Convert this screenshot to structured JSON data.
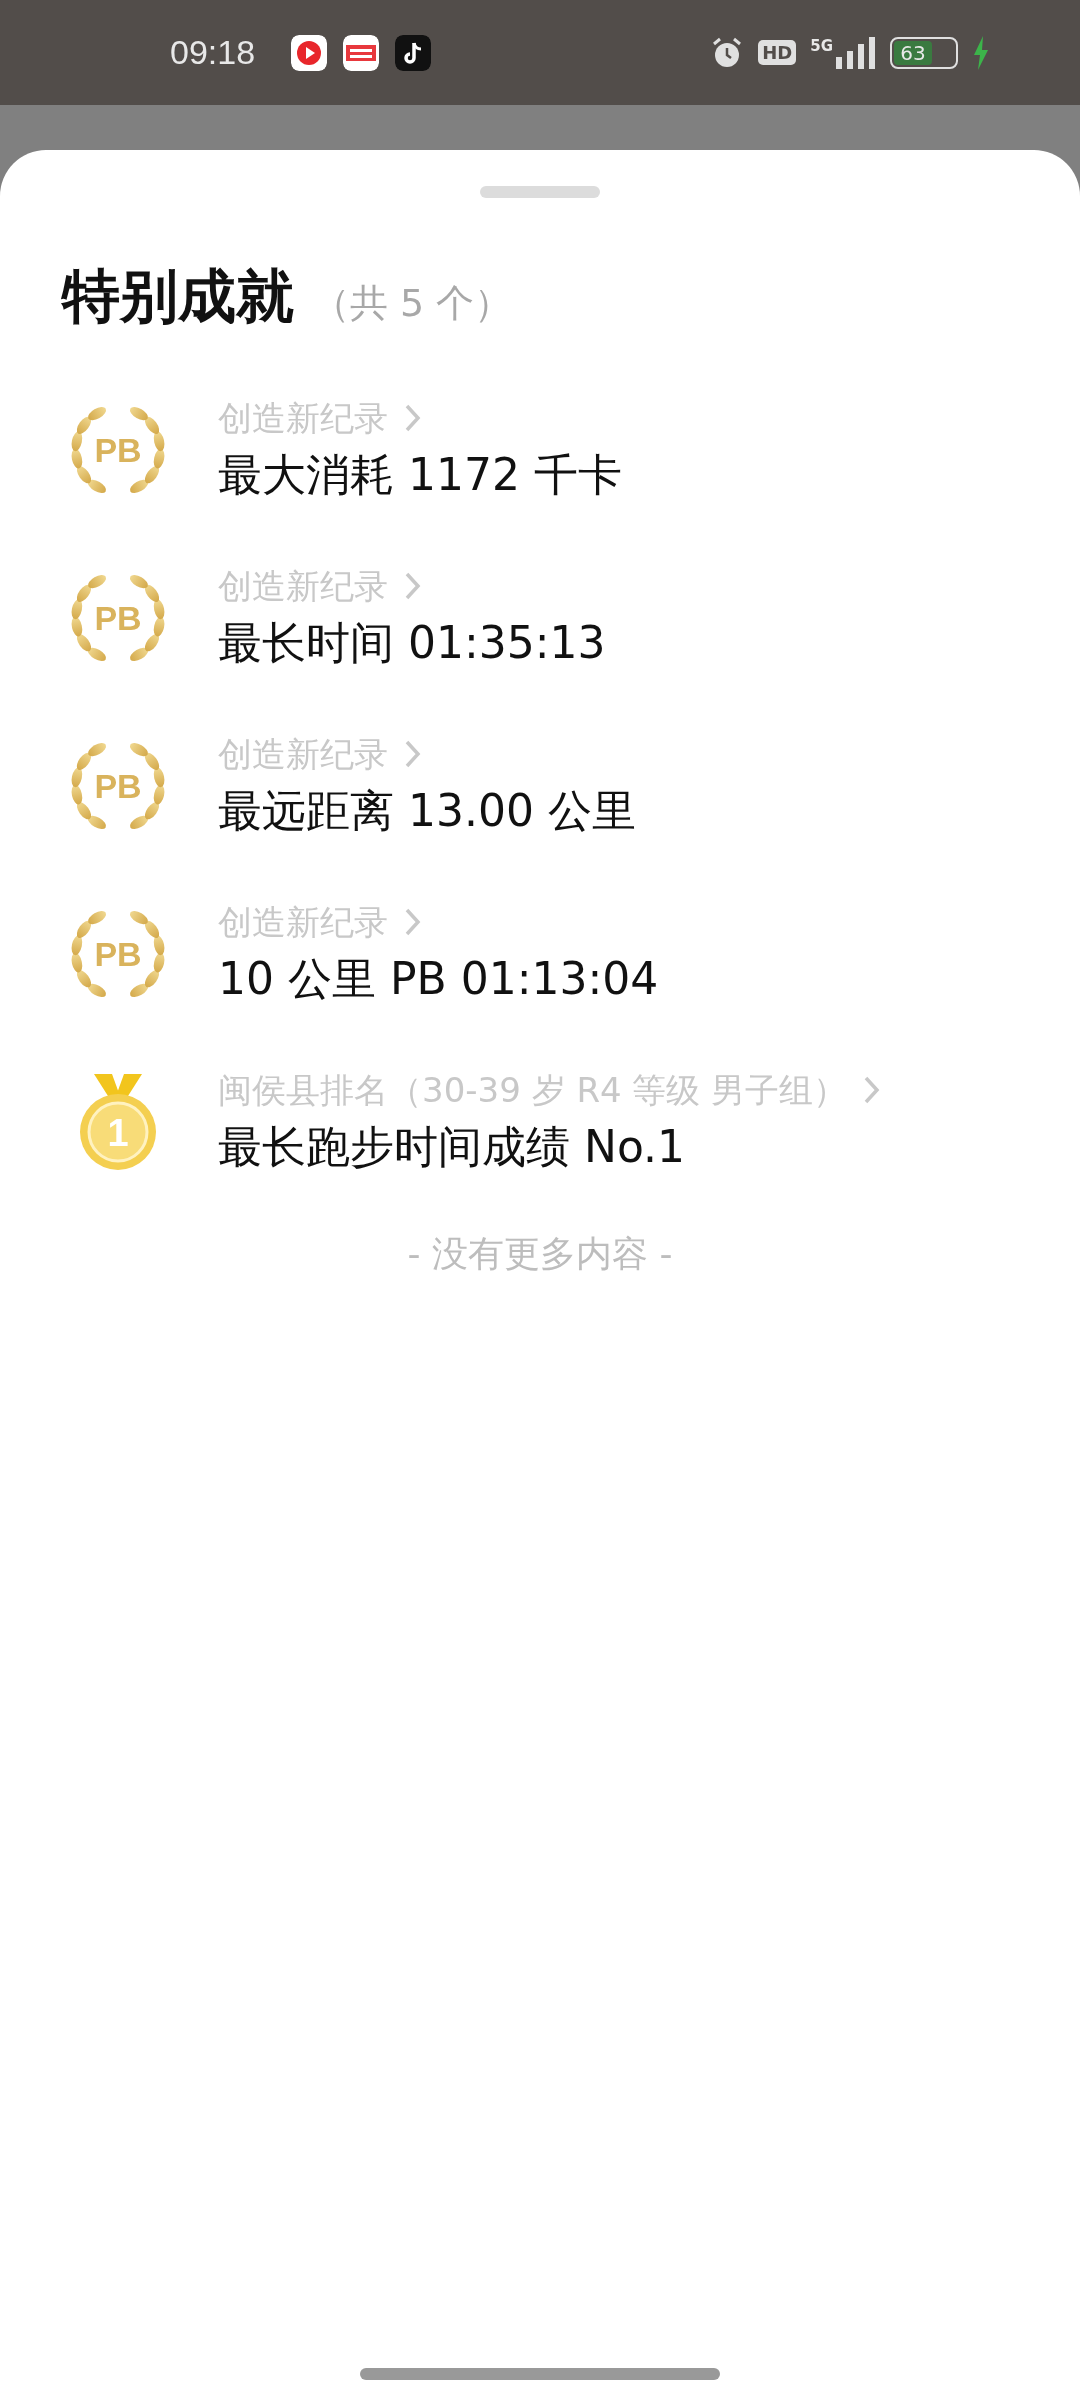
{
  "status_bar": {
    "time": "09:18",
    "hd": "HD",
    "network": "5G",
    "battery": "63"
  },
  "title": "特别成就",
  "count": "（共 5 个）",
  "achievements": [
    {
      "kind": "pb",
      "badge": "PB",
      "subtitle": "创造新纪录",
      "value": "最大消耗 1172 千卡"
    },
    {
      "kind": "pb",
      "badge": "PB",
      "subtitle": "创造新纪录",
      "value": "最长时间 01:35:13"
    },
    {
      "kind": "pb",
      "badge": "PB",
      "subtitle": "创造新纪录",
      "value": "最远距离 13.00 公里"
    },
    {
      "kind": "pb",
      "badge": "PB",
      "subtitle": "创造新纪录",
      "value": "10 公里 PB 01:13:04"
    },
    {
      "kind": "medal",
      "badge": "1",
      "subtitle": "闽侯县排名（30-39 岁 R4 等级 男子组）",
      "value": "最长跑步时间成绩 No.1"
    }
  ],
  "footer": "- 没有更多内容 -"
}
